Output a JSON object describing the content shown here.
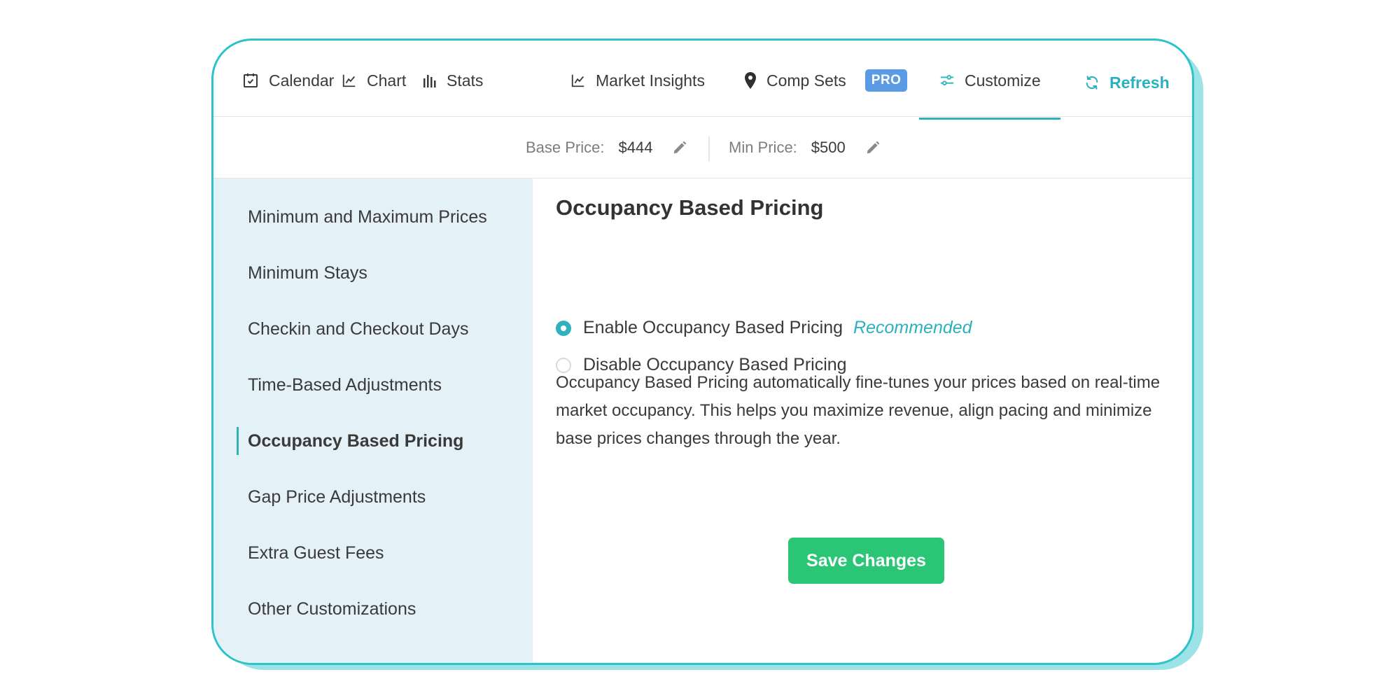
{
  "tabs": [
    {
      "label": "Calendar",
      "icon": "calendar-icon"
    },
    {
      "label": "Chart",
      "icon": "line-chart-icon"
    },
    {
      "label": "Stats",
      "icon": "bar-chart-icon"
    },
    {
      "label": "Market Insights",
      "icon": "line-chart-icon"
    },
    {
      "label": "Comp Sets",
      "icon": "map-pin-icon",
      "badge": "PRO"
    },
    {
      "label": "Customize",
      "icon": "sliders-icon",
      "active": true
    },
    {
      "label": "Refresh",
      "icon": "refresh-icon"
    }
  ],
  "prices": {
    "base_label": "Base Price:",
    "base_value": "$444",
    "min_label": "Min Price:",
    "min_value": "$500"
  },
  "sidebar": {
    "items": [
      {
        "label": "Minimum and Maximum Prices"
      },
      {
        "label": "Minimum Stays"
      },
      {
        "label": "Checkin and Checkout Days"
      },
      {
        "label": "Time-Based Adjustments"
      },
      {
        "label": "Occupancy Based Pricing",
        "active": true
      },
      {
        "label": "Gap Price Adjustments"
      },
      {
        "label": "Extra Guest Fees"
      },
      {
        "label": "Other Customizations"
      }
    ]
  },
  "main": {
    "title": "Occupancy Based Pricing",
    "options": [
      {
        "label": "Enable Occupancy Based Pricing",
        "selected": true,
        "tag": "Recommended"
      },
      {
        "label": "Disable Occupancy Based Pricing",
        "selected": false
      }
    ],
    "description": "Occupancy Based Pricing automatically fine-tunes your prices based on real-time market occupancy. This helps you maximize revenue, align pacing and minimize base prices changes through the year.",
    "save_label": "Save Changes"
  },
  "colors": {
    "accent": "#2fb2bd",
    "border": "#2cc3cb",
    "save": "#2ac676",
    "pro_badge": "#5b9be6",
    "sidebar_bg": "#e4f1f6"
  }
}
